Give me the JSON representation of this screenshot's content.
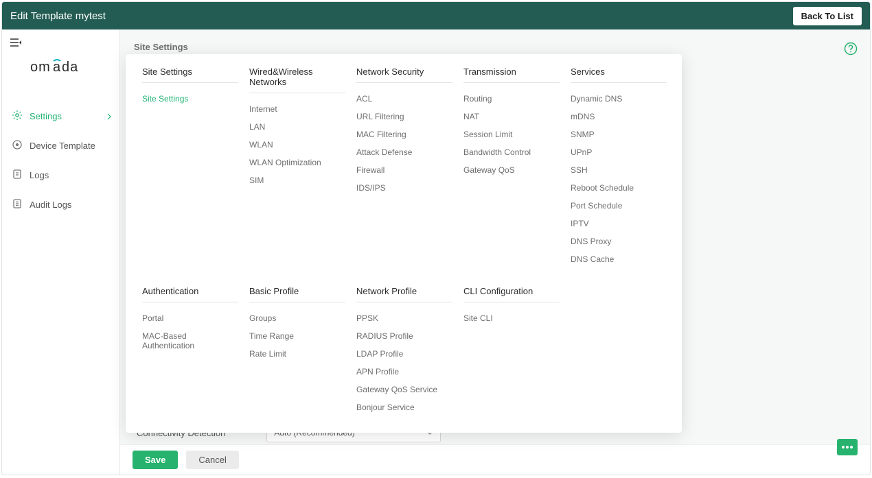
{
  "header": {
    "title": "Edit Template mytest",
    "back_label": "Back To List"
  },
  "brand": "omāda",
  "sidebar": {
    "items": [
      {
        "label": "Settings",
        "active": true,
        "hasChevron": true,
        "icon": "gear-icon"
      },
      {
        "label": "Device Template",
        "active": false,
        "hasChevron": false,
        "icon": "target-icon"
      },
      {
        "label": "Logs",
        "active": false,
        "hasChevron": false,
        "icon": "doc-icon"
      },
      {
        "label": "Audit Logs",
        "active": false,
        "hasChevron": false,
        "icon": "list-icon"
      }
    ]
  },
  "breadcrumb": "Site Settings",
  "mega": {
    "rows": [
      [
        {
          "header": "Site Settings",
          "items": [
            {
              "label": "Site Settings",
              "active": true
            }
          ]
        },
        {
          "header": "Wired&Wireless Networks",
          "items": [
            {
              "label": "Internet"
            },
            {
              "label": "LAN"
            },
            {
              "label": "WLAN"
            },
            {
              "label": "WLAN Optimization"
            },
            {
              "label": "SIM"
            }
          ]
        },
        {
          "header": "Network Security",
          "items": [
            {
              "label": "ACL"
            },
            {
              "label": "URL Filtering"
            },
            {
              "label": "MAC Filtering"
            },
            {
              "label": "Attack Defense"
            },
            {
              "label": "Firewall"
            },
            {
              "label": "IDS/IPS"
            }
          ]
        },
        {
          "header": "Transmission",
          "items": [
            {
              "label": "Routing"
            },
            {
              "label": "NAT"
            },
            {
              "label": "Session Limit"
            },
            {
              "label": "Bandwidth Control"
            },
            {
              "label": "Gateway QoS"
            }
          ]
        },
        {
          "header": "Services",
          "items": [
            {
              "label": "Dynamic DNS"
            },
            {
              "label": "mDNS"
            },
            {
              "label": "SNMP"
            },
            {
              "label": "UPnP"
            },
            {
              "label": "SSH"
            },
            {
              "label": "Reboot Schedule"
            },
            {
              "label": "Port Schedule"
            },
            {
              "label": "IPTV"
            },
            {
              "label": "DNS Proxy"
            },
            {
              "label": "DNS Cache"
            }
          ]
        }
      ],
      [
        {
          "header": "Authentication",
          "items": [
            {
              "label": "Portal"
            },
            {
              "label": "MAC-Based Authentication"
            }
          ]
        },
        {
          "header": "Basic Profile",
          "items": [
            {
              "label": "Groups"
            },
            {
              "label": "Time Range"
            },
            {
              "label": "Rate Limit"
            }
          ]
        },
        {
          "header": "Network Profile",
          "items": [
            {
              "label": "PPSK"
            },
            {
              "label": "RADIUS Profile"
            },
            {
              "label": "LDAP Profile"
            },
            {
              "label": "APN Profile"
            },
            {
              "label": "Gateway QoS Service"
            },
            {
              "label": "Bonjour Service"
            }
          ]
        },
        {
          "header": "CLI Configuration",
          "items": [
            {
              "label": "Site CLI"
            }
          ]
        }
      ]
    ]
  },
  "settings": {
    "connectivity_label": "Connectivity Detection",
    "connectivity_value": "Auto (Recommended)"
  },
  "footer": {
    "save_label": "Save",
    "cancel_label": "Cancel"
  }
}
